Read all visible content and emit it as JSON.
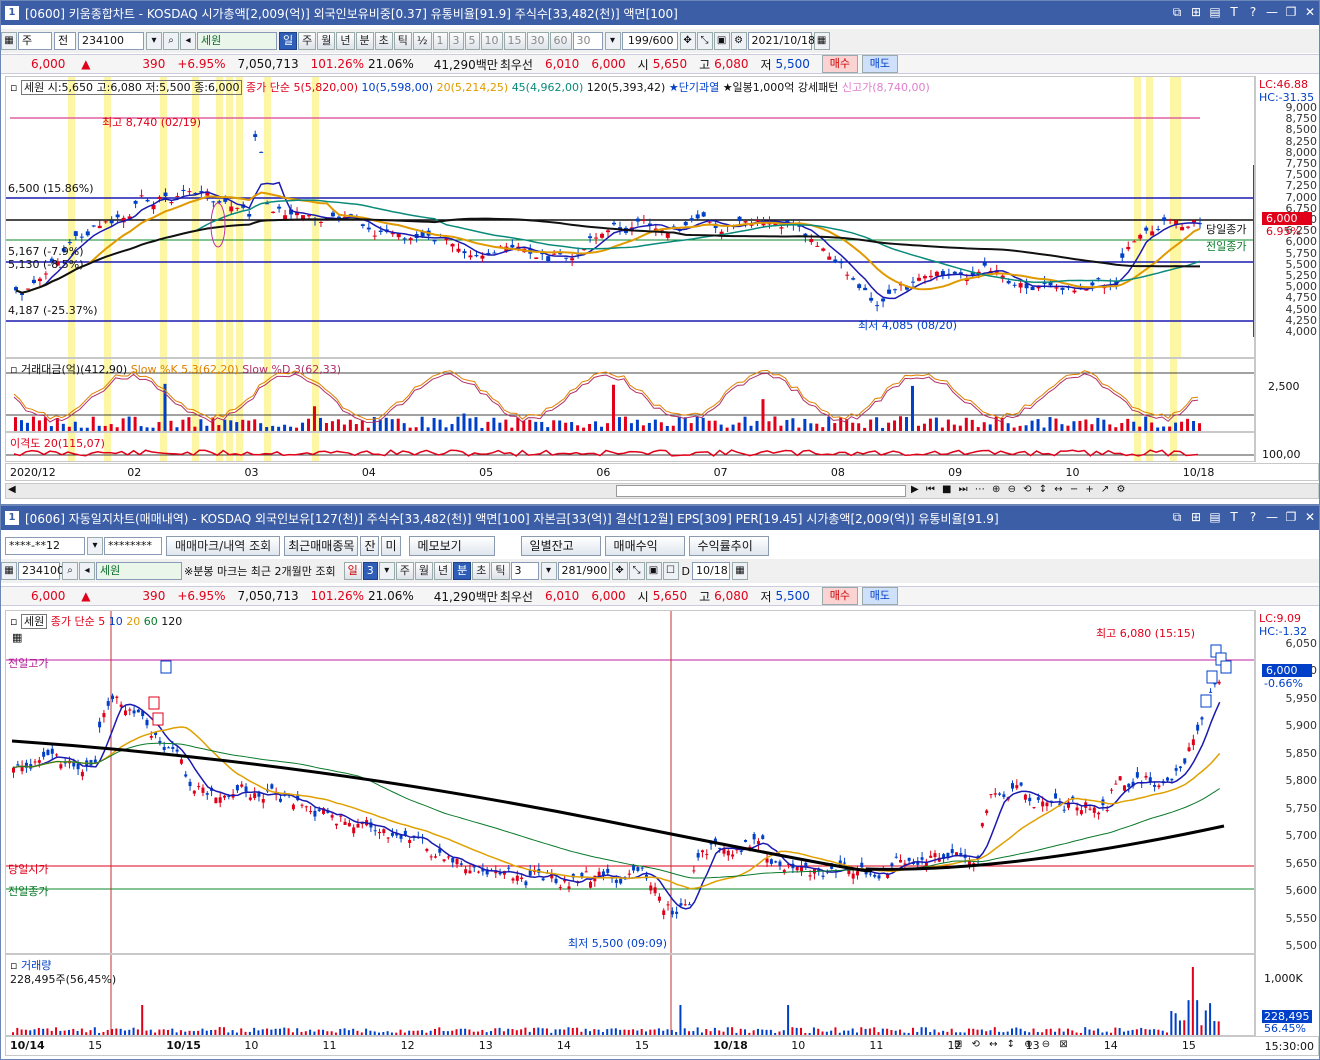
{
  "top": {
    "title": "[0600] 키움종합차트 - KOSDAQ 시가총액[2,009(억)] 외국인보유비중[0.37] 유통비율[91.9] 주식수[33,482(천)] 액면[100]",
    "win_num": "1",
    "toolbar": {
      "mode1": "주",
      "mode2": "전",
      "code": "234100",
      "name": "세원",
      "periods": [
        "일",
        "주",
        "월",
        "년",
        "분",
        "초",
        "틱",
        "½",
        "1",
        "3",
        "5",
        "10",
        "15",
        "30",
        "60",
        "30"
      ],
      "count": "199/600",
      "date": "2021/10/18"
    },
    "price": {
      "cur": "6,000",
      "arrow": "▲",
      "chg": "390",
      "pct": "+6.95%",
      "vol": "7,050,713",
      "ratio": "101.26%",
      "turn": "21.06%",
      "amt": "41,290백만",
      "pri_label": "최우선",
      "pri1": "6,010",
      "pri2": "6,000",
      "o_label": "시",
      "open": "5,650",
      "h_label": "고",
      "high": "6,080",
      "l_label": "저",
      "low": "5,500",
      "buy": "매수",
      "sell": "매도"
    },
    "legend": {
      "ohlc": "세원 시:5,650 고:6,080 저:5,500 종:6,000",
      "ma": "종가 단순",
      "ma5": "5(5,820,00)",
      "ma10": "10(5,598,00)",
      "ma20": "20(5,214,25)",
      "ma45": "45(4,962,00)",
      "ma120": "120(5,393,42)",
      "sig1": "★단기과열",
      "sig2": "★일봉1,000억 강세패턴",
      "sig3": "신고가(8,740,00)"
    },
    "annotations": {
      "high": "최고 8,740 (02/19)",
      "low": "최저 4,085 (08/20)",
      "lvl1": "6,500 (15.86%)",
      "lvl2": "5,167 (-7.9%)",
      "lvl2b": "5,130 (-8.5%)",
      "lvl3": "4,187 (-25.37%)",
      "today_close": "당일종가",
      "prev_close": "전일종가"
    },
    "axis": [
      "9,000",
      "8,750",
      "8,500",
      "8,250",
      "8,000",
      "7,750",
      "7,500",
      "7,250",
      "7,000",
      "6,750",
      "6,500",
      "6,250",
      "6,000",
      "5,750",
      "5,500",
      "5,250",
      "5,000",
      "4,750",
      "4,500",
      "4,250",
      "4,000"
    ],
    "axis_tags": {
      "lc": "LC:46.88",
      "hc": "HC:-31.35",
      "cur": "6,000",
      "pct": "6.95%"
    },
    "sub1": {
      "label": "거래대금(억)(412,90)",
      "k": "Slow %K 5,3(62,20)",
      "d": "Slow %D 3(62,33)",
      "axis": "2,500"
    },
    "sub2": {
      "label": "이격도 20(115,07)",
      "axis": "100,00"
    },
    "xlabels": [
      "2020/12",
      "02",
      "03",
      "04",
      "05",
      "06",
      "07",
      "08",
      "09",
      "10",
      "10/18"
    ]
  },
  "bottom": {
    "title": "[0606] 자동일지차트(매매내역) - KOSDAQ 외국인보유[127(천)] 주식수[33,482(천)] 액면[100] 자본금[33(억)] 결산[12월] EPS[309] PER[19.45] 시가총액[2,009(억)] 유통비율[91.9]",
    "win_num": "1",
    "row1": {
      "account": "****-**12",
      "pwd": "********",
      "b1": "매매마크/내역 조회",
      "b2": "최근매매종목",
      "b3": "잔",
      "b4": "미",
      "b5": "메모보기",
      "b6": "일별잔고",
      "b7": "매매수익",
      "b8": "수익률추이"
    },
    "row2": {
      "code": "234100",
      "name": "세원",
      "note": "※분봉 마크는 최근 2개월만 조회",
      "periods": [
        "일",
        "3",
        "주",
        "월",
        "년",
        "분",
        "초",
        "틱",
        "3"
      ],
      "count": "281/900",
      "date": "10/18",
      "d_label": "D"
    },
    "price": {
      "cur": "6,000",
      "arrow": "▲",
      "chg": "390",
      "pct": "+6.95%",
      "vol": "7,050,713",
      "ratio": "101.26%",
      "turn": "21.06%",
      "amt": "41,290백만",
      "pri_label": "최우선",
      "pri1": "6,010",
      "pri2": "6,000",
      "o_label": "시",
      "open": "5,650",
      "h_label": "고",
      "high": "6,080",
      "l_label": "저",
      "low": "5,500",
      "buy": "매수",
      "sell": "매도"
    },
    "legend": {
      "name": "세원",
      "ma": "종가 단순",
      "m5": "5",
      "m10": "10",
      "m20": "20",
      "m60": "60",
      "m120": "120"
    },
    "annotations": {
      "high": "최고 6,080 (15:15)",
      "low": "최저 5,500 (09:09)",
      "prev_high": "전일고가",
      "today_open": "당일시가",
      "prev_close": "전일종가"
    },
    "axis": [
      "6,050",
      "6,000",
      "5,950",
      "5,900",
      "5,850",
      "5,800",
      "5,750",
      "5,700",
      "5,650",
      "5,600",
      "5,550",
      "5,500"
    ],
    "axis_tags": {
      "lc": "LC:9.09",
      "hc": "HC:-1.32",
      "cur": "6,000",
      "pct": "-0.66%"
    },
    "vol": {
      "label": "거래량",
      "value": "228,495주(56,45%)",
      "axis": "1,000K",
      "tag": "228,495",
      "tagpct": "56.45%"
    },
    "xlabels": [
      "10/14",
      "15",
      "10/15",
      "10",
      "11",
      "12",
      "13",
      "14",
      "15",
      "10/18",
      "10",
      "11",
      "12",
      "13",
      "14",
      "15"
    ],
    "time": "15:30:00"
  }
}
